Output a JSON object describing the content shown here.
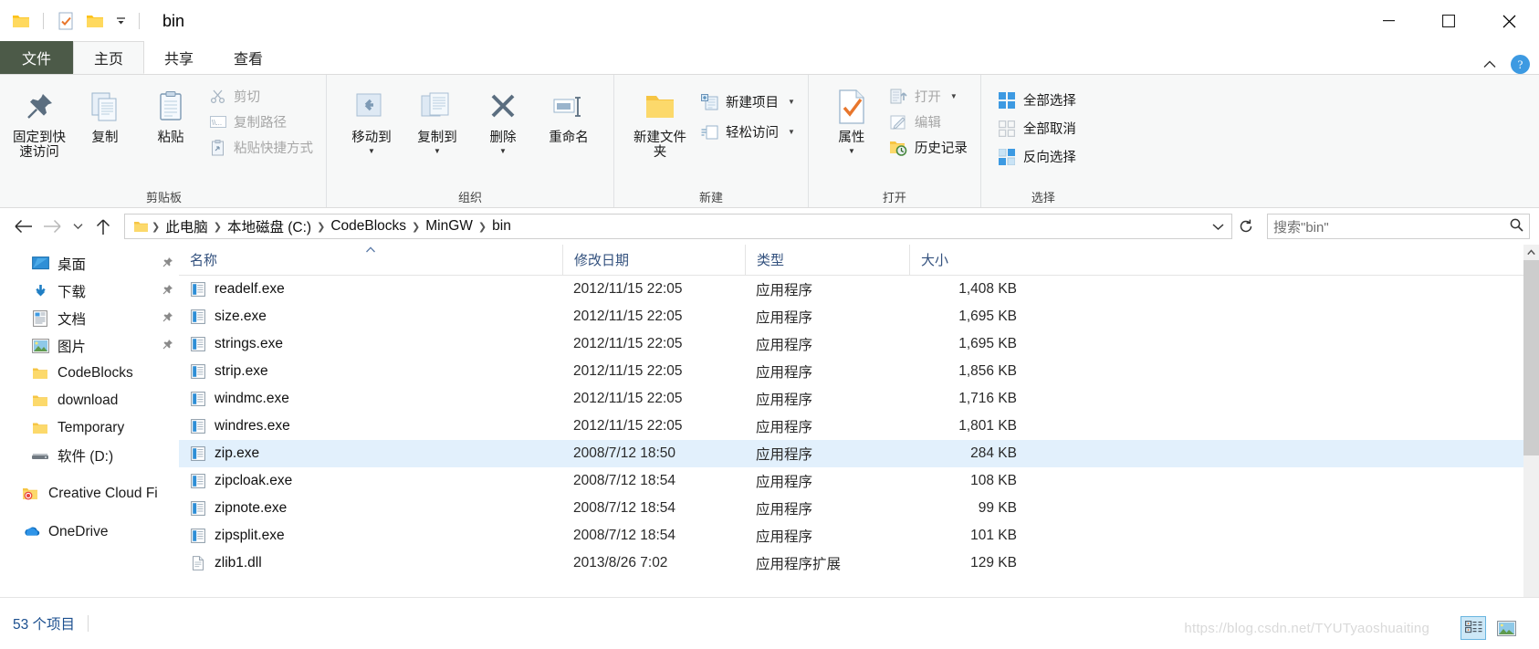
{
  "window": {
    "title": "bin",
    "quick_access_icons": [
      "folder-icon",
      "checkbox-properties-icon",
      "new-folder-icon"
    ],
    "caption": {
      "minimize": "minimize-icon",
      "maximize": "maximize-icon",
      "close": "close-icon"
    }
  },
  "ribbon": {
    "tabs": [
      {
        "id": "file",
        "label": "文件"
      },
      {
        "id": "home",
        "label": "主页"
      },
      {
        "id": "share",
        "label": "共享"
      },
      {
        "id": "view",
        "label": "查看"
      }
    ],
    "active_tab": "主页",
    "collapse_icon": "chevron-up-icon",
    "help_label": "?",
    "groups": [
      {
        "name": "剪贴板",
        "big_buttons": [
          {
            "label": "固定到快速访问",
            "icon": "pin-icon"
          },
          {
            "label": "复制",
            "icon": "copy-icon"
          },
          {
            "label": "粘贴",
            "icon": "paste-icon"
          }
        ],
        "small_buttons": [
          {
            "label": "剪切",
            "icon": "scissors-icon",
            "disabled": true
          },
          {
            "label": "复制路径",
            "icon": "copy-path-icon",
            "disabled": true
          },
          {
            "label": "粘贴快捷方式",
            "icon": "paste-shortcut-icon",
            "disabled": true
          }
        ]
      },
      {
        "name": "组织",
        "big_buttons": [
          {
            "label": "移动到",
            "icon": "move-to-icon",
            "has_caret": true
          },
          {
            "label": "复制到",
            "icon": "copy-to-icon",
            "has_caret": true
          },
          {
            "label": "删除",
            "icon": "delete-x-icon",
            "has_caret": true
          },
          {
            "label": "重命名",
            "icon": "rename-icon"
          }
        ],
        "small_buttons": []
      },
      {
        "name": "新建",
        "big_buttons": [
          {
            "label": "新建文件夹",
            "icon": "new-folder-icon"
          }
        ],
        "small_buttons": [
          {
            "label": "新建项目",
            "icon": "new-item-icon",
            "has_caret": true
          },
          {
            "label": "轻松访问",
            "icon": "easy-access-icon",
            "has_caret": true
          }
        ]
      },
      {
        "name": "打开",
        "big_buttons": [
          {
            "label": "属性",
            "icon": "properties-icon",
            "has_caret": true
          }
        ],
        "small_buttons": [
          {
            "label": "打开",
            "icon": "open-icon",
            "has_caret": true,
            "disabled": true
          },
          {
            "label": "编辑",
            "icon": "edit-icon",
            "disabled": true
          },
          {
            "label": "历史记录",
            "icon": "history-icon"
          }
        ]
      },
      {
        "name": "选择",
        "big_buttons": [],
        "small_buttons": [
          {
            "label": "全部选择",
            "icon": "select-all-icon"
          },
          {
            "label": "全部取消",
            "icon": "select-none-icon"
          },
          {
            "label": "反向选择",
            "icon": "invert-selection-icon"
          }
        ]
      }
    ]
  },
  "navigation": {
    "back_icon": "arrow-left-icon",
    "forward_icon": "arrow-right-icon",
    "recent_icon": "chevron-down-icon",
    "up_icon": "arrow-up-icon",
    "breadcrumbs": [
      "此电脑",
      "本地磁盘 (C:)",
      "CodeBlocks",
      "MinGW",
      "bin"
    ],
    "dropdown_icon": "chevron-down-icon",
    "refresh_icon": "refresh-icon",
    "search": {
      "placeholder": "搜索\"bin\"",
      "value": "",
      "icon": "search-icon"
    }
  },
  "sidebar": {
    "items": [
      {
        "label": "桌面",
        "icon": "desktop-icon",
        "pinned": true
      },
      {
        "label": "下载",
        "icon": "download-icon",
        "pinned": true
      },
      {
        "label": "文档",
        "icon": "documents-icon",
        "pinned": true
      },
      {
        "label": "图片",
        "icon": "pictures-icon",
        "pinned": true
      },
      {
        "label": "CodeBlocks",
        "icon": "folder-icon",
        "pinned": false
      },
      {
        "label": "download",
        "icon": "folder-icon",
        "pinned": false
      },
      {
        "label": "Temporary",
        "icon": "folder-icon",
        "pinned": false
      },
      {
        "label": "软件 (D:)",
        "icon": "drive-icon",
        "pinned": false
      },
      {
        "label": "Creative Cloud Fi",
        "icon": "creative-cloud-folder-icon",
        "pinned": false,
        "gap_before": true
      },
      {
        "label": "OneDrive",
        "icon": "onedrive-icon",
        "pinned": false,
        "gap_before": true
      }
    ]
  },
  "filelist": {
    "columns": [
      {
        "key": "name",
        "label": "名称",
        "sorted": "asc"
      },
      {
        "key": "date",
        "label": "修改日期"
      },
      {
        "key": "type",
        "label": "类型"
      },
      {
        "key": "size",
        "label": "大小"
      }
    ],
    "rows": [
      {
        "name": "readelf.exe",
        "date": "2012/11/15 22:05",
        "type": "应用程序",
        "size": "1,408 KB",
        "icon": "exe-icon",
        "selected": false
      },
      {
        "name": "size.exe",
        "date": "2012/11/15 22:05",
        "type": "应用程序",
        "size": "1,695 KB",
        "icon": "exe-icon",
        "selected": false
      },
      {
        "name": "strings.exe",
        "date": "2012/11/15 22:05",
        "type": "应用程序",
        "size": "1,695 KB",
        "icon": "exe-icon",
        "selected": false
      },
      {
        "name": "strip.exe",
        "date": "2012/11/15 22:05",
        "type": "应用程序",
        "size": "1,856 KB",
        "icon": "exe-icon",
        "selected": false
      },
      {
        "name": "windmc.exe",
        "date": "2012/11/15 22:05",
        "type": "应用程序",
        "size": "1,716 KB",
        "icon": "exe-icon",
        "selected": false
      },
      {
        "name": "windres.exe",
        "date": "2012/11/15 22:05",
        "type": "应用程序",
        "size": "1,801 KB",
        "icon": "exe-icon",
        "selected": false
      },
      {
        "name": "zip.exe",
        "date": "2008/7/12 18:50",
        "type": "应用程序",
        "size": "284 KB",
        "icon": "exe-icon",
        "selected": true
      },
      {
        "name": "zipcloak.exe",
        "date": "2008/7/12 18:54",
        "type": "应用程序",
        "size": "108 KB",
        "icon": "exe-icon",
        "selected": false
      },
      {
        "name": "zipnote.exe",
        "date": "2008/7/12 18:54",
        "type": "应用程序",
        "size": "99 KB",
        "icon": "exe-icon",
        "selected": false
      },
      {
        "name": "zipsplit.exe",
        "date": "2008/7/12 18:54",
        "type": "应用程序",
        "size": "101 KB",
        "icon": "exe-icon",
        "selected": false
      },
      {
        "name": "zlib1.dll",
        "date": "2013/8/26 7:02",
        "type": "应用程序扩展",
        "size": "129 KB",
        "icon": "dll-icon",
        "selected": false
      }
    ]
  },
  "statusbar": {
    "item_count": "53 个项目",
    "watermark": "https://blog.csdn.net/TYUTyaoshuaiting",
    "view_buttons": [
      {
        "name": "details-view",
        "icon": "details-view-icon",
        "active": true
      },
      {
        "name": "large-icons-view",
        "icon": "thumbnails-view-icon",
        "active": false
      }
    ]
  },
  "colors": {
    "file_tab_green": "#4c5a48",
    "selection_blue": "#e2f0fc",
    "header_blue": "#33517e",
    "accent_orange": "#e8762c"
  }
}
